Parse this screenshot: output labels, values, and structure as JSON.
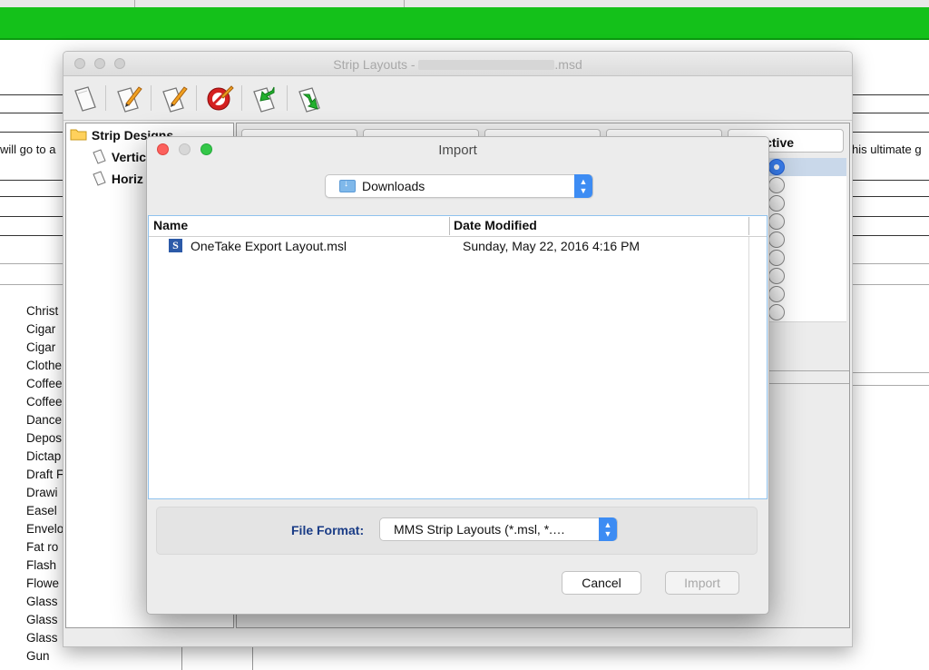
{
  "background_app": {
    "left_text": "will go to a",
    "right_text": "his ultimate g",
    "list_items": [
      "Christ",
      "Cigar",
      "Cigar",
      "Clothe",
      "Coffee",
      "Coffee",
      "Dance",
      "Depos",
      "Dictap",
      "Draft F",
      "Drawi",
      "Easel",
      "Envelo",
      "Fat ro",
      "Flash",
      "Flowe",
      "Glass",
      "Glass",
      "Glass",
      "Gun"
    ]
  },
  "strip_window": {
    "title_prefix": "Strip Layouts - ",
    "title_suffix": ".msd",
    "tree": {
      "root": "Strip Designs",
      "children": [
        "Vertic",
        "Horiz"
      ]
    },
    "grid": {
      "active_header": "Active",
      "rows": 9,
      "selected_row": 0
    },
    "toolbar_icons": [
      "new-layout-icon",
      "edit-layout-icon",
      "edit-copy-icon",
      "delete-icon",
      "import-icon",
      "export-icon"
    ]
  },
  "import_dialog": {
    "title": "Import",
    "location": "Downloads",
    "columns": {
      "name": "Name",
      "date": "Date Modified"
    },
    "files": [
      {
        "icon": "S",
        "name": "OneTake Export Layout.msl",
        "date": "Sunday, May 22, 2016 4:16 PM"
      }
    ],
    "format_label": "File Format:",
    "format_value": "MMS Strip Layouts  (*.msl, *.…",
    "cancel_label": "Cancel",
    "import_label": "Import",
    "colors": {
      "accent": "#3d8cf3",
      "title_bar_green": "#14c11a",
      "close_red": "#fc605c",
      "zoom_green": "#34c748"
    }
  }
}
